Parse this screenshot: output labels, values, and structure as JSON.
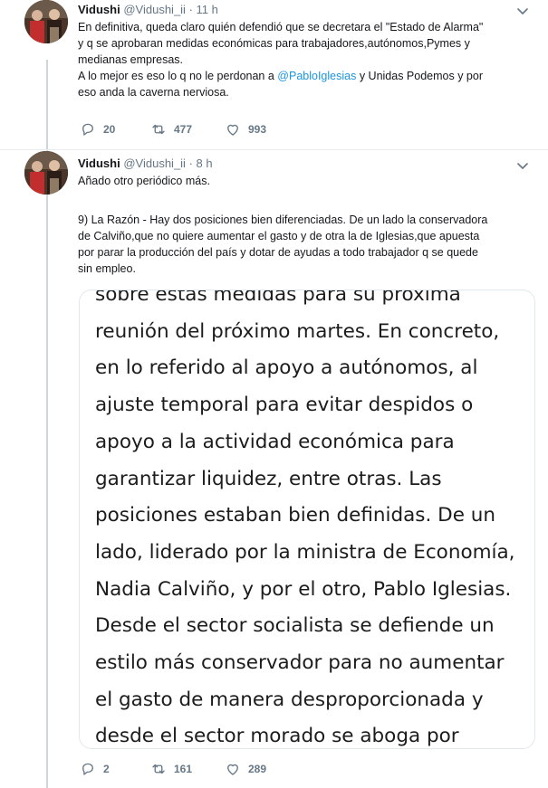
{
  "tweets": [
    {
      "author": {
        "name": "Vidushi",
        "handle": "@Vidushi_ii",
        "time": "11 h"
      },
      "text_lines": [
        "En definitiva, queda claro quién defendió que se decretara el \"Estado de Alarma\"",
        "y q se aprobaran medidas económicas para trabajadores,autónomos,Pymes y",
        "medianas empresas."
      ],
      "text_last": {
        "before": "A lo mejor es eso lo q no le perdonan a ",
        "mention": "@PabloIglesias",
        "after": " y Unidas Podemos y por",
        "line2": "eso anda la caverna nerviosa."
      },
      "actions": {
        "replies": "20",
        "retweets": "477",
        "likes": "993"
      }
    },
    {
      "author": {
        "name": "Vidushi",
        "handle": "@Vidushi_ii",
        "time": "8 h"
      },
      "text1": "Añado otro periódico más.",
      "text2_lines": [
        "9) La Razón -  Hay dos posiciones bien diferenciadas. De un lado la conservadora",
        "de Calviño,que no quiere aumentar el gasto y de otra la de Iglesias,que apuesta",
        "por parar la producción del país y dotar de ayudas a todo trabajador q se quede",
        "sin empleo."
      ],
      "quoted_lines": [
        "sobre estas medidas para su próxima",
        "reunión del próximo martes. En concreto,",
        "en lo referido al apoyo a autónomos, al",
        "ajuste temporal para evitar despidos o",
        "apoyo a la actividad económica para",
        "garantizar liquidez, entre otras. Las",
        "posiciones estaban bien definidas. De un",
        "lado, liderado por la ministra de Economía,",
        "Nadia Calviño, y por el otro, Pablo Iglesias.",
        "Desde el sector socialista se defiende un",
        "estilo más conservador para no aumentar",
        "el gasto de manera desproporcionada y",
        "desde el sector morado se aboga por"
      ],
      "actions": {
        "replies": "2",
        "retweets": "161",
        "likes": "289"
      }
    }
  ],
  "colors": {
    "link": "#1b95e0",
    "muted": "#657786",
    "thread_line": "#ccd6dd"
  }
}
